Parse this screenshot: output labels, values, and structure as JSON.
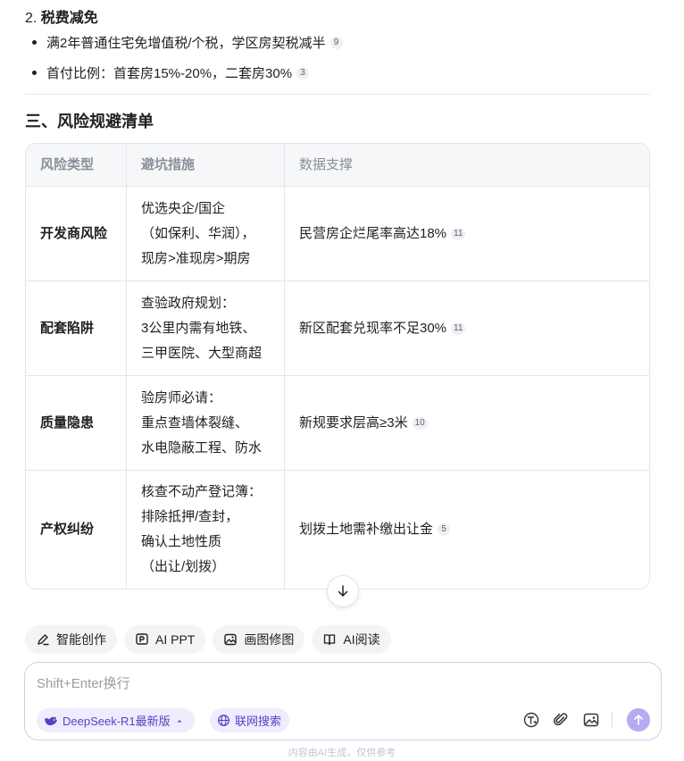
{
  "tax": {
    "number": "2.",
    "title": "税费减免",
    "bullets": [
      {
        "text": "满2年普通住宅免增值税/个税，学区房契税减半",
        "cite": "9"
      },
      {
        "text": "首付比例：首套房15%-20%，二套房30%",
        "cite": "3"
      }
    ]
  },
  "section_title": "三、风险规避清单",
  "risk_table": {
    "headers": [
      "风险类型",
      "避坑措施",
      "数据支撑"
    ],
    "rows": [
      {
        "type": "开发商风险",
        "measure_lines": [
          "优选央企/国企",
          "（如保利、华润），",
          "现房>准现房>期房"
        ],
        "data": "民营房企烂尾率高达18%",
        "cite": "11"
      },
      {
        "type": "配套陷阱",
        "measure_lines": [
          "查验政府规划：",
          "3公里内需有地铁、",
          "三甲医院、大型商超"
        ],
        "data": "新区配套兑现率不足30%",
        "cite": "11"
      },
      {
        "type": "质量隐患",
        "measure_lines": [
          "验房师必请：",
          "重点查墙体裂缝、",
          "水电隐蔽工程、防水"
        ],
        "data": "新规要求层高≥3米",
        "cite": "10"
      },
      {
        "type": "产权纠纷",
        "measure_lines": [
          "核查不动产登记簿：",
          "排除抵押/查封，",
          "确认土地性质",
          "（出让/划拨）"
        ],
        "data": "划拨土地需补缴出让金",
        "cite": "5"
      }
    ]
  },
  "toolbar": {
    "items": [
      {
        "label": "智能创作",
        "icon": "pen-sparkle-icon"
      },
      {
        "label": "AI PPT",
        "icon": "ppt-icon"
      },
      {
        "label": "画图修图",
        "icon": "image-edit-icon"
      },
      {
        "label": "AI阅读",
        "icon": "book-read-icon"
      }
    ]
  },
  "composer": {
    "placeholder": "Shift+Enter换行",
    "model_label": "DeepSeek-R1最新版",
    "web_search_label": "联网搜索"
  },
  "footer_note": "内容由AI生成，仅供参考",
  "colors": {
    "accent": "#5b3fc4",
    "chip_bg": "#f0ecfd",
    "send_disabled": "#b7a9f2",
    "table_border": "#e5e6eb"
  }
}
